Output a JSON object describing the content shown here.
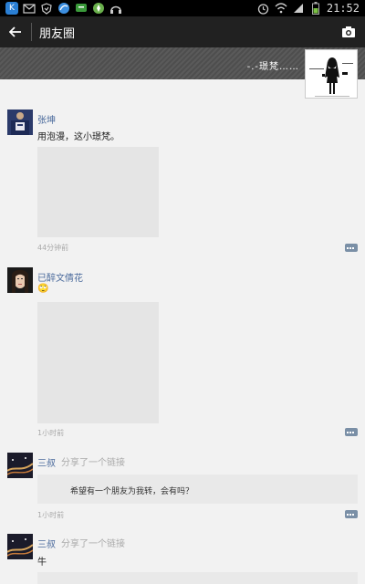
{
  "status_bar": {
    "time": "21:52",
    "icons": [
      "k-app-icon",
      "mail-icon",
      "shield-icon",
      "browser-icon",
      "chat-icon",
      "map-icon",
      "headphones-icon",
      "alarm-icon",
      "wifi-icon",
      "signal-icon",
      "battery-icon"
    ],
    "accent": "#2a7fd4"
  },
  "header": {
    "title": "朋友圈"
  },
  "profile": {
    "name": "-.-璟梵……"
  },
  "posts": [
    {
      "name": "张坤",
      "text": "用泡漫，这小璟梵。",
      "time": "44分钟前"
    },
    {
      "name": "已醉文倩花",
      "text": "🙄",
      "time": "1小时前"
    },
    {
      "name": "三叔",
      "share": "分享了一个链接",
      "link_text": "希望有一个朋友为我转，会有吗？",
      "time": "1小时前"
    },
    {
      "name": "三叔",
      "share": "分享了一个链接",
      "text": "牛"
    }
  ],
  "colors": {
    "name_link": "#4a6a9c",
    "app_bar": "#212121"
  }
}
